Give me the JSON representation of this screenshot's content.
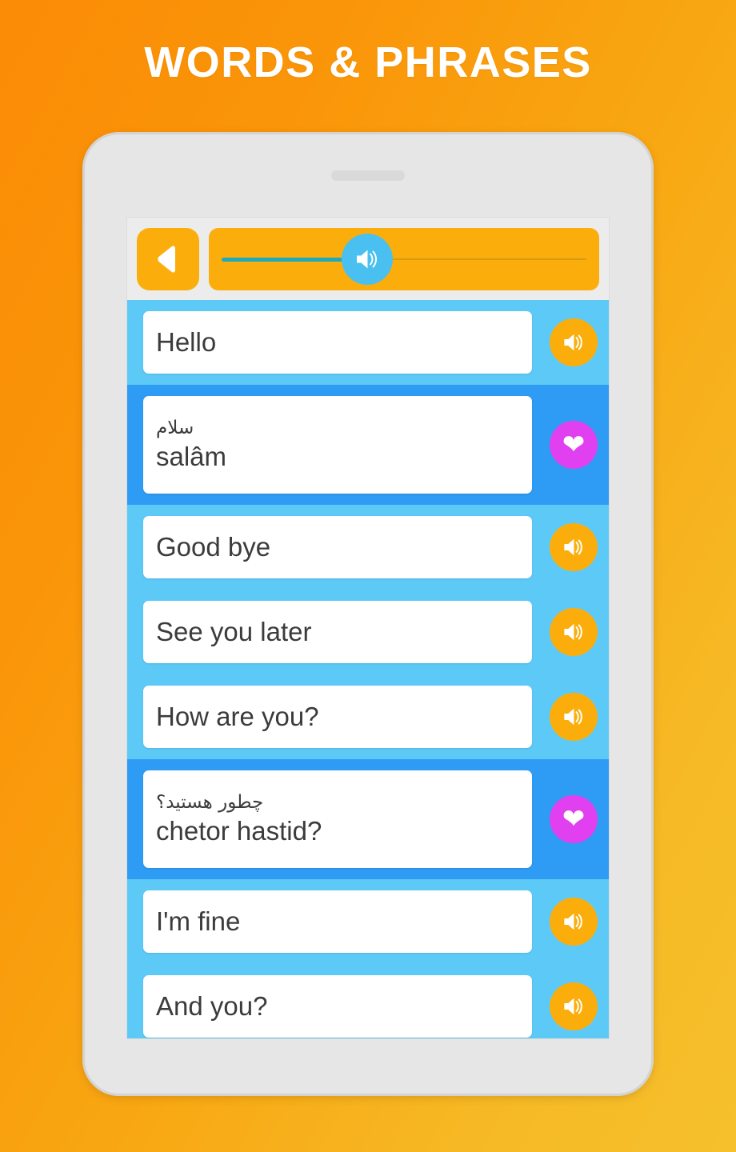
{
  "header": {
    "title": "WORDS & PHRASES"
  },
  "colors": {
    "background_start": "#FB8C05",
    "background_end": "#F5C02C",
    "accent_orange": "#FBAE0B",
    "row_english": "#5DC9F7",
    "row_translation": "#2E9BF5",
    "heart_magenta": "#E040F0",
    "slider_thumb": "#49C0EF",
    "slider_fill": "#1FA9BC",
    "text": "#3B3B3B"
  },
  "toolbar": {
    "back_icon": "back-triangle-icon",
    "slider": {
      "thumb_icon": "speaker-icon",
      "value_percent": 34
    }
  },
  "list": {
    "rows": [
      {
        "type": "english",
        "text": "Hello",
        "action_icon": "speaker-icon"
      },
      {
        "type": "translation",
        "native": "سلام",
        "translit": "salâm",
        "action_icon": "heart-icon"
      },
      {
        "type": "english",
        "text": "Good bye",
        "action_icon": "speaker-icon"
      },
      {
        "type": "english",
        "text": "See you later",
        "action_icon": "speaker-icon"
      },
      {
        "type": "english",
        "text": "How are you?",
        "action_icon": "speaker-icon"
      },
      {
        "type": "translation",
        "native": "چطور هستید؟",
        "translit": "chetor hastid?",
        "action_icon": "heart-icon"
      },
      {
        "type": "english",
        "text": "I'm fine",
        "action_icon": "speaker-icon"
      },
      {
        "type": "english",
        "text": "And you?",
        "action_icon": "speaker-icon"
      }
    ]
  }
}
